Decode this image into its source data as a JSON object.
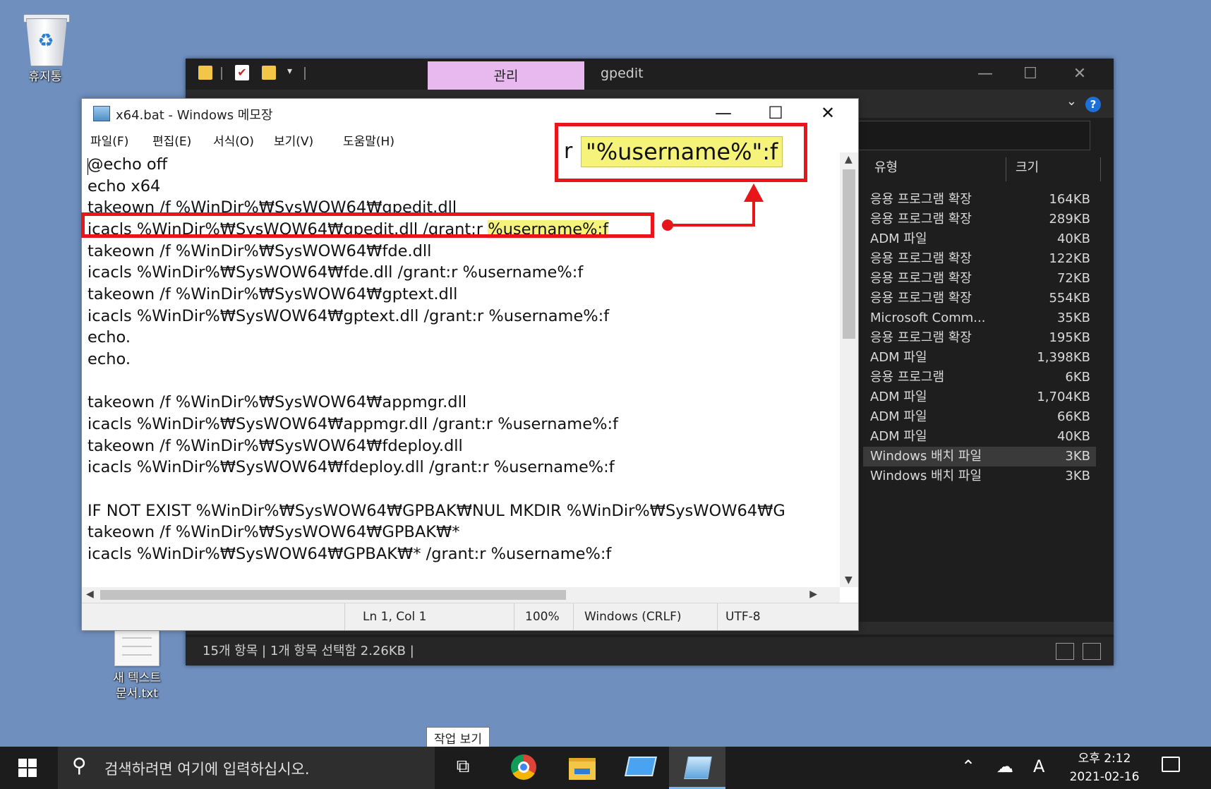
{
  "desktop": {
    "recycle_bin_label": "휴지통",
    "text_file_label_line1": "새 텍스트",
    "text_file_label_line2": "문서.txt"
  },
  "explorer": {
    "tab_manage_label": "관리",
    "window_title": "gpedit",
    "columns": {
      "type": "유형",
      "size": "크기"
    },
    "files": [
      {
        "type": "응용 프로그램 확장",
        "size": "164KB"
      },
      {
        "type": "응용 프로그램 확장",
        "size": "289KB"
      },
      {
        "type": "ADM 파일",
        "size": "40KB"
      },
      {
        "type": "응용 프로그램 확장",
        "size": "122KB"
      },
      {
        "type": "응용 프로그램 확장",
        "size": "72KB"
      },
      {
        "type": "응용 프로그램 확장",
        "size": "554KB"
      },
      {
        "type": "Microsoft Comm...",
        "size": "35KB"
      },
      {
        "type": "응용 프로그램 확장",
        "size": "195KB"
      },
      {
        "type": "ADM 파일",
        "size": "1,398KB"
      },
      {
        "type": "응용 프로그램",
        "size": "6KB"
      },
      {
        "type": "ADM 파일",
        "size": "1,704KB"
      },
      {
        "type": "ADM 파일",
        "size": "66KB"
      },
      {
        "type": "ADM 파일",
        "size": "40KB"
      },
      {
        "type": "Windows 배치 파일",
        "size": "3KB"
      },
      {
        "type": "Windows 배치 파일",
        "size": "3KB"
      }
    ],
    "status_text": "15개 항목  |  1개 항목 선택함 2.26KB  |"
  },
  "notepad": {
    "title": "x64.bat - Windows 메모장",
    "menus": [
      "파일(F)",
      "편집(E)",
      "서식(O)",
      "보기(V)",
      "도움말(H)"
    ],
    "lines": [
      "@echo off",
      "echo x64",
      "takeown /f %WinDir%₩SysWOW64₩gpedit.dll",
      "icacls %WinDir%₩SysWOW64₩gpedit.dll /grant:r ",
      "takeown /f %WinDir%₩SysWOW64₩fde.dll",
      "icacls %WinDir%₩SysWOW64₩fde.dll /grant:r %username%:f",
      "takeown /f %WinDir%₩SysWOW64₩gptext.dll",
      "icacls %WinDir%₩SysWOW64₩gptext.dll /grant:r %username%:f",
      "echo.",
      "echo.",
      "",
      "takeown /f %WinDir%₩SysWOW64₩appmgr.dll",
      "icacls %WinDir%₩SysWOW64₩appmgr.dll /grant:r %username%:f",
      "takeown /f %WinDir%₩SysWOW64₩fdeploy.dll",
      "icacls %WinDir%₩SysWOW64₩fdeploy.dll /grant:r %username%:f",
      "",
      "IF NOT EXIST %WinDir%₩SysWOW64₩GPBAK₩NUL MKDIR %WinDir%₩SysWOW64₩G",
      "takeown /f %WinDir%₩SysWOW64₩GPBAK₩*",
      "icacls %WinDir%₩SysWOW64₩GPBAK₩* /grant:r %username%:f"
    ],
    "highlight_text": "%username%:f",
    "status": {
      "position": "Ln 1, Col 1",
      "zoom": "100%",
      "line_ending": "Windows (CRLF)",
      "encoding": "UTF-8"
    }
  },
  "annotation": {
    "zoom_prefix": "r",
    "zoom_text": "\"%username%\":f",
    "color": "#e8161b",
    "highlight_color": "#f6f37a"
  },
  "tooltip": "작업 보기",
  "taskbar": {
    "search_placeholder": "검색하려면 여기에 입력하십시오.",
    "ime": "A",
    "time": "오후 2:12",
    "date": "2021-02-16"
  }
}
